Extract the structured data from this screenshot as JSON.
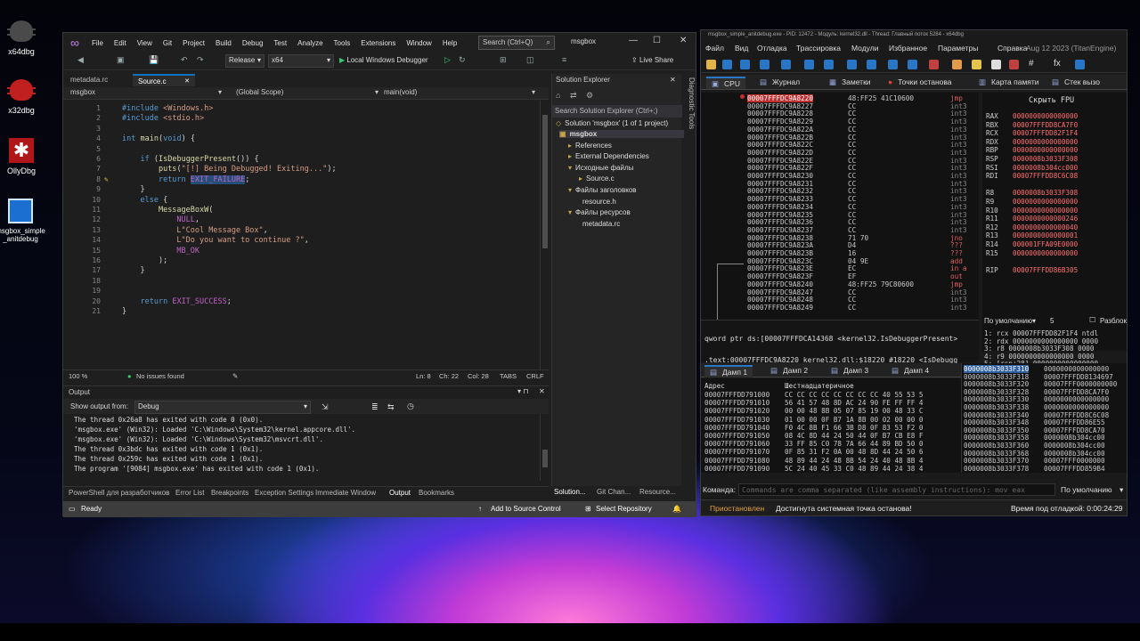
{
  "desktop": {
    "icons": [
      {
        "label": "x64dbg"
      },
      {
        "label": "x32dbg"
      },
      {
        "label": "OllyDbg"
      },
      {
        "label": "msgbox_simple_anitdebug"
      }
    ]
  },
  "vs": {
    "menu": [
      "File",
      "Edit",
      "View",
      "Git",
      "Project",
      "Build",
      "Debug",
      "Test",
      "Analyze",
      "Tools",
      "Extensions",
      "Window",
      "Help"
    ],
    "search_placeholder": "Search (Ctrl+Q)",
    "project_name": "msgbox",
    "toolbar": {
      "config": "Release",
      "platform": "x64",
      "run_label": "Local Windows Debugger",
      "live_share": "Live Share"
    },
    "doc_tabs": [
      "metadata.rc",
      "Source.c"
    ],
    "nav": {
      "project": "msgbox",
      "scope": "(Global Scope)",
      "member": "main(void)"
    },
    "editor": {
      "lines": [
        {
          "n": "1",
          "html": "<span class=\"kw\">#include</span> <span class=\"str\">&lt;Windows.h&gt;</span>"
        },
        {
          "n": "2",
          "html": "<span class=\"kw\">#include</span> <span class=\"str\">&lt;stdio.h&gt;</span>"
        },
        {
          "n": "3",
          "html": ""
        },
        {
          "n": "4",
          "html": "<span class=\"kw\">int</span> <span class=\"fn\">main</span>(<span class=\"kw\">void</span>) {"
        },
        {
          "n": "5",
          "html": ""
        },
        {
          "n": "6",
          "html": "    <span class=\"kw\">if</span> (<span class=\"fn\">IsDebuggerPresent</span>()) {"
        },
        {
          "n": "7",
          "html": "        <span class=\"fn\">puts</span>(<span class=\"str\">\"[!] Being Debugged! Exiting...\"</span>);"
        },
        {
          "n": "8",
          "html": "        <span class=\"kw\">return</span> <span class=\"mac sel\">EXIT_FAILURE</span>;"
        },
        {
          "n": "9",
          "html": "    }"
        },
        {
          "n": "10",
          "html": "    <span class=\"kw\">else</span> {"
        },
        {
          "n": "11",
          "html": "        <span class=\"fn\">MessageBoxW</span>("
        },
        {
          "n": "12",
          "html": "            <span class=\"mac\">NULL</span>,"
        },
        {
          "n": "13",
          "html": "            <span class=\"str\">L\"Cool Message Box\"</span>,"
        },
        {
          "n": "14",
          "html": "            <span class=\"str\">L\"Do you want to continue ?\"</span>,"
        },
        {
          "n": "15",
          "html": "            <span class=\"mac\">MB_OK</span>"
        },
        {
          "n": "16",
          "html": "        );"
        },
        {
          "n": "17",
          "html": "    }"
        },
        {
          "n": "18",
          "html": ""
        },
        {
          "n": "19",
          "html": ""
        },
        {
          "n": "20",
          "html": "    <span class=\"kw\">return</span> <span class=\"mac\">EXIT_SUCCESS</span>;"
        },
        {
          "n": "21",
          "html": "}"
        }
      ]
    },
    "editor_status": {
      "zoom": "100 %",
      "issues": "No issues found",
      "ln": "Ln: 8",
      "ch": "Ch: 22",
      "col": "Col: 28",
      "tabs": "TABS",
      "eol": "CRLF"
    },
    "output": {
      "title": "Output",
      "show_from_label": "Show output from:",
      "source": "Debug",
      "lines": [
        "The thread 0x26a8 has exited with code 0 (0x0).",
        "'msgbox.exe' (Win32): Loaded 'C:\\Windows\\System32\\kernel.appcore.dll'.",
        "'msgbox.exe' (Win32): Loaded 'C:\\Windows\\System32\\msvcrt.dll'.",
        "The thread 0x3bdc has exited with code 1 (0x1).",
        "The thread 0x259c has exited with code 1 (0x1).",
        "The program '[9084] msgbox.exe' has exited with code 1 (0x1)."
      ]
    },
    "bottom_tabs": [
      "PowerShell для разработчиков",
      "Error List",
      "Breakpoints",
      "Exception Settings",
      "Immediate Window",
      "Output",
      "Bookmarks"
    ],
    "solution": {
      "title": "Solution Explorer",
      "search_placeholder": "Search Solution Explorer (Ctrl+;)",
      "items": [
        "Solution 'msgbox' (1 of 1 project)",
        "msgbox",
        "References",
        "External Dependencies",
        "Исходные файлы",
        "Source.c",
        "Файлы заголовков",
        "resource.h",
        "Файлы ресурсов",
        "metadata.rc"
      ],
      "bottom_tabs": [
        "Solution...",
        "Git Chan...",
        "Resource..."
      ]
    },
    "diagnostic_label": "Diagnostic Tools",
    "status": {
      "ready": "Ready",
      "source_control": "Add to Source Control",
      "repository": "Select Repository"
    }
  },
  "dbg": {
    "title": "msgbox_simple_anitdebug.exe - PID: 12472 - Модуль: kernel32.dll - Thread: Главный поток 5284 - x64dbg",
    "menu": [
      "Файл",
      "Вид",
      "Отладка",
      "Трассировка",
      "Модули",
      "Избранное",
      "Параметры",
      "Справка",
      "Aug 12 2023 (TitanEngine)"
    ],
    "tabs": [
      "CPU",
      "Журнал",
      "Заметки",
      "Точки останова",
      "Карта памяти",
      "Стек вызо"
    ],
    "fpu_label": "Скрыть FPU",
    "disasm": [
      {
        "addr": "00007FFFDC9A8220",
        "bytes": "48:FF25 41C10600",
        "inst": "jmp",
        "cur": true
      },
      {
        "addr": "00007FFFDC9A8227",
        "bytes": "CC",
        "inst": "int3"
      },
      {
        "addr": "00007FFFDC9A8228",
        "bytes": "CC",
        "inst": "int3"
      },
      {
        "addr": "00007FFFDC9A8229",
        "bytes": "CC",
        "inst": "int3"
      },
      {
        "addr": "00007FFFDC9A822A",
        "bytes": "CC",
        "inst": "int3"
      },
      {
        "addr": "00007FFFDC9A822B",
        "bytes": "CC",
        "inst": "int3"
      },
      {
        "addr": "00007FFFDC9A822C",
        "bytes": "CC",
        "inst": "int3"
      },
      {
        "addr": "00007FFFDC9A822D",
        "bytes": "CC",
        "inst": "int3"
      },
      {
        "addr": "00007FFFDC9A822E",
        "bytes": "CC",
        "inst": "int3"
      },
      {
        "addr": "00007FFFDC9A822F",
        "bytes": "CC",
        "inst": "int3"
      },
      {
        "addr": "00007FFFDC9A8230",
        "bytes": "CC",
        "inst": "int3"
      },
      {
        "addr": "00007FFFDC9A8231",
        "bytes": "CC",
        "inst": "int3"
      },
      {
        "addr": "00007FFFDC9A8232",
        "bytes": "CC",
        "inst": "int3"
      },
      {
        "addr": "00007FFFDC9A8233",
        "bytes": "CC",
        "inst": "int3"
      },
      {
        "addr": "00007FFFDC9A8234",
        "bytes": "CC",
        "inst": "int3"
      },
      {
        "addr": "00007FFFDC9A8235",
        "bytes": "CC",
        "inst": "int3"
      },
      {
        "addr": "00007FFFDC9A8236",
        "bytes": "CC",
        "inst": "int3"
      },
      {
        "addr": "00007FFFDC9A8237",
        "bytes": "CC",
        "inst": "int3"
      },
      {
        "addr": "00007FFFDC9A8238",
        "bytes": "71 70",
        "inst": "jno"
      },
      {
        "addr": "00007FFFDC9A823A",
        "bytes": "D4",
        "inst": "???"
      },
      {
        "addr": "00007FFFDC9A823B",
        "bytes": "16",
        "inst": "???"
      },
      {
        "addr": "00007FFFDC9A823C",
        "bytes": "04 9E",
        "inst": "add"
      },
      {
        "addr": "00007FFFDC9A823E",
        "bytes": "EC",
        "inst": "in a"
      },
      {
        "addr": "00007FFFDC9A823F",
        "bytes": "EF",
        "inst": "out"
      },
      {
        "addr": "00007FFFDC9A8240",
        "bytes": "48:FF25 79C80600",
        "inst": "jmp"
      },
      {
        "addr": "00007FFFDC9A8247",
        "bytes": "CC",
        "inst": "int3"
      },
      {
        "addr": "00007FFFDC9A8248",
        "bytes": "CC",
        "inst": "int3"
      },
      {
        "addr": "00007FFFDC9A8249",
        "bytes": "CC",
        "inst": "int3"
      }
    ],
    "registers": [
      {
        "name": "RAX",
        "value": "0000000000000000"
      },
      {
        "name": "RBX",
        "value": "00007FFFDD8CA7F0"
      },
      {
        "name": "RCX",
        "value": "00007FFFDD82F1F4"
      },
      {
        "name": "RDX",
        "value": "0000000000000000"
      },
      {
        "name": "RBP",
        "value": "0000000000000000"
      },
      {
        "name": "RSP",
        "value": "0000008b3033F308"
      },
      {
        "name": "RSI",
        "value": "0000008b304cc000"
      },
      {
        "name": "RDI",
        "value": "00007FFFDD8C6C08"
      },
      {
        "name": "",
        "value": ""
      },
      {
        "name": "R8",
        "value": "0000008b3033F308"
      },
      {
        "name": "R9",
        "value": "0000000000000000"
      },
      {
        "name": "R10",
        "value": "0000000000000000"
      },
      {
        "name": "R11",
        "value": "0000000000000246"
      },
      {
        "name": "R12",
        "value": "0000000000000040"
      },
      {
        "name": "R13",
        "value": "0000000000000001"
      },
      {
        "name": "R14",
        "value": "000001FFA09E0000"
      },
      {
        "name": "R15",
        "value": "0000000000000000"
      },
      {
        "name": "",
        "value": ""
      },
      {
        "name": "RIP",
        "value": "00007FFFDD86B305"
      }
    ],
    "call_conv": {
      "label": "По умолчанию",
      "count": "5",
      "unlock": "Разблок"
    },
    "args": [
      "1: rcx 00007FFFDD82F1F4 ntdl",
      "2: rdx 0000000000000000 0000",
      "3: r8 0000008b3033F308 0000",
      "4: r9 0000000000000000 0000",
      "5: [rsp+28] 0000000000000000"
    ],
    "info_line1": "qword ptr ds:[00007FFFDCA14368 <kernel32.IsDebuggerPresent>",
    "info_line2": ".text:00007FFFDC9A8220 kernel32.dll:$18220 #18220 <IsDebugg",
    "dump_tabs": [
      "Дамп 1",
      "Дамп 2",
      "Дамп 3",
      "Дамп 4"
    ],
    "dump_header": {
      "addr": "Адрес",
      "hex": "Шестнадцатеричное"
    },
    "dump": [
      {
        "addr": "00007FFFDD791000",
        "hex": "CC CC CC CC CC CC CC CC 40 55 53 5"
      },
      {
        "addr": "00007FFFDD791010",
        "hex": "56 41 57 48 8D AC 24 90 FE FF FF 4"
      },
      {
        "addr": "00007FFFDD791020",
        "hex": "00 00 48 8B 05 07 85 19 00 48 33 C"
      },
      {
        "addr": "00007FFFDD791030",
        "hex": "01 00 00 0F B7 1A 8B 00 02 00 00 0"
      },
      {
        "addr": "00007FFFDD791040",
        "hex": "F0 4C 8B F1 66 3B D8 0F 83 53 F2 0"
      },
      {
        "addr": "00007FFFDD791050",
        "hex": "08 4C 8D 44 24 50 44 0F B7 CB E8 F"
      },
      {
        "addr": "00007FFFDD791060",
        "hex": "33 FF 85 C0 78 7A 66 44 89 BD 50 0"
      },
      {
        "addr": "00007FFFDD791070",
        "hex": "0F 85 31 F2 0A 00 48 8D 44 24 50 6"
      },
      {
        "addr": "00007FFFDD791080",
        "hex": "48 89 44 24 48 8B 54 24 40 48 8B 4"
      },
      {
        "addr": "00007FFFDD791090",
        "hex": "5C 24 40 45 33 C0 48 89 44 24 38 4"
      }
    ],
    "stack": [
      {
        "addr": "0000008b3033F310",
        "val": "0000000000000000"
      },
      {
        "addr": "0000008b3033F318",
        "val": "00007FFFDD8134697"
      },
      {
        "addr": "0000008b3033F320",
        "val": "00007FFF0000000000"
      },
      {
        "addr": "0000008b3033F328",
        "val": "00007FFFDD8CA7F0"
      },
      {
        "addr": "0000008b3033F330",
        "val": "0000000000000000"
      },
      {
        "addr": "0000008b3033F338",
        "val": "0000000000000000"
      },
      {
        "addr": "0000008b3033F340",
        "val": "00007FFFDD8C6C08"
      },
      {
        "addr": "0000008b3033F348",
        "val": "00007FFFDD86E55"
      },
      {
        "addr": "0000008b3033F350",
        "val": "00007FFFDD8CA70"
      },
      {
        "addr": "0000008b3033F358",
        "val": "0000008b304cc00"
      },
      {
        "addr": "0000008b3033F360",
        "val": "0000008b304cc00"
      },
      {
        "addr": "0000008b3033F368",
        "val": "0000008b304cc00"
      },
      {
        "addr": "0000008b3033F370",
        "val": "00007FFF0000000"
      },
      {
        "addr": "0000008b3033F378",
        "val": "00007FFFDD859B4"
      }
    ],
    "command_label": "Команда:",
    "command_placeholder": "Commands are comma separated (like assembly instructions): mov eax",
    "command_mode": "По умолчанию",
    "status": {
      "state": "Приостановлен",
      "message": "Достигнута системная точка останова!",
      "time": "Время под отладкой: 0:00:24:29"
    }
  }
}
